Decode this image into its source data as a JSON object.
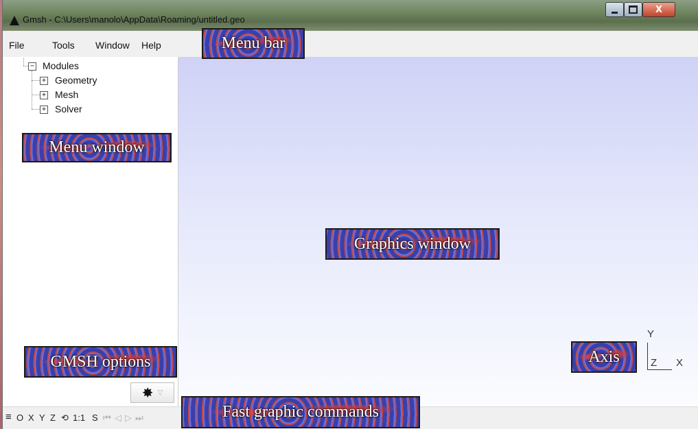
{
  "window": {
    "title": "Gmsh - C:\\Users\\manolo\\AppData\\Roaming/untitled.geo",
    "buttons": {
      "minimize": "",
      "maximize": "",
      "close": "X"
    }
  },
  "menubar": {
    "items": [
      {
        "label": "File"
      },
      {
        "label": "Tools"
      },
      {
        "label": "Window"
      },
      {
        "label": "Help"
      }
    ]
  },
  "tree": {
    "root": {
      "label": "Modules",
      "expander": "−"
    },
    "children": [
      {
        "label": "Geometry",
        "expander": "+"
      },
      {
        "label": "Mesh",
        "expander": "+"
      },
      {
        "label": "Solver",
        "expander": "+"
      }
    ]
  },
  "axis": {
    "y": "Y",
    "z": "Z",
    "x": "X"
  },
  "statusbar": {
    "menu_icon": "≡",
    "o": "O",
    "x": "X",
    "y": "Y",
    "z": "Z",
    "rotate_icon": "⟲",
    "scale": "1:1",
    "s": "S",
    "nav_first": "⏮",
    "nav_prev": "◁",
    "nav_next": "▷",
    "nav_last": "⏭"
  },
  "options_button": {
    "icon": "gear-icon",
    "glyph": "✸",
    "arrow": "▽"
  },
  "annotations": {
    "menu_bar": "Menu bar",
    "menu_window": "Menu window",
    "graphics_window": "Graphics window",
    "gmsh_options": "GMSH options",
    "fast_graphic_commands": "Fast graphic commands",
    "axis": "Axis"
  },
  "colors": {
    "graphics_top": "#cfd2f6",
    "graphics_bottom": "#fbfcff",
    "titlebar": "#6f865f",
    "close_button": "#c3432a"
  }
}
